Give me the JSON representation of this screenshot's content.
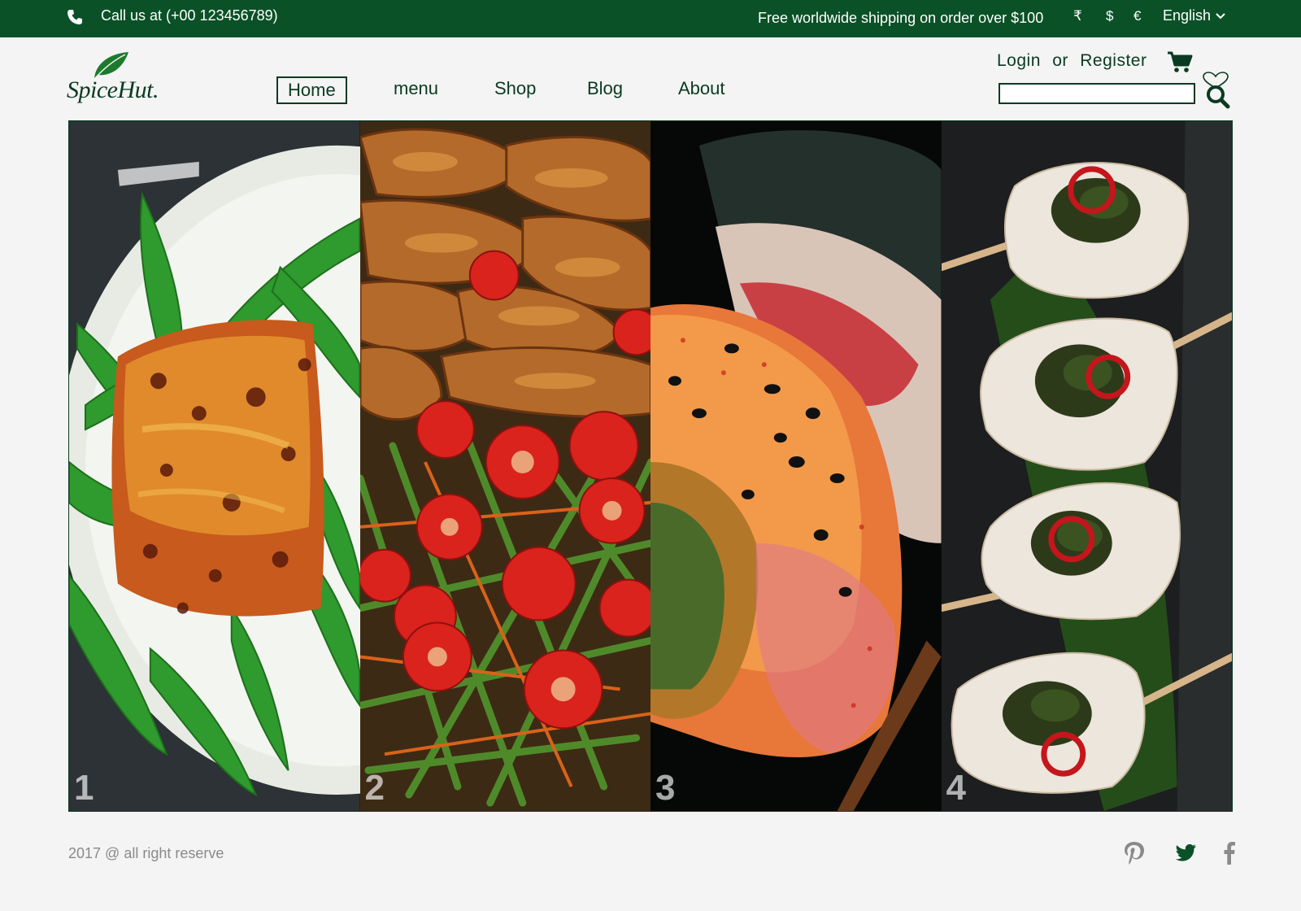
{
  "topbar": {
    "call": "Call us at (+00 123456789)",
    "shipping": "Free worldwide shipping on order over $100",
    "currencies": [
      "₹",
      "$",
      "€"
    ],
    "language": "English"
  },
  "header": {
    "logo_text": "SpiceHut.",
    "nav": [
      "Home",
      "menu",
      "Shop",
      "Blog",
      "About"
    ],
    "active_nav": "Home",
    "login": "Login",
    "or": "or",
    "register": "Register",
    "search_value": ""
  },
  "gallery": {
    "panels": [
      {
        "number": "1",
        "dish": "glazed fish on snow peas"
      },
      {
        "number": "2",
        "dish": "chicken with asparagus and cherry tomatoes"
      },
      {
        "number": "3",
        "dish": "sushi roll"
      },
      {
        "number": "4",
        "dish": "fish skewers with chili"
      }
    ]
  },
  "footer": {
    "copyright": "2017 @ all right reserve",
    "social": [
      "pinterest-icon",
      "twitter-icon",
      "facebook-icon"
    ]
  },
  "colors": {
    "brand_green": "#0b5127",
    "text_dark": "#0b3a22",
    "background": "#f4f4f4",
    "footer_text": "#8a8a8a"
  }
}
